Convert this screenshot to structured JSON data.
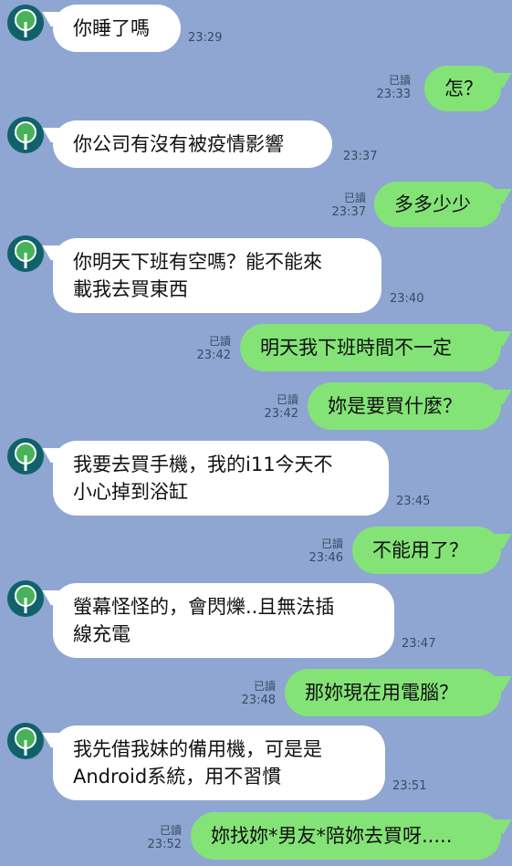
{
  "colors": {
    "background": "#8ea6d1",
    "incoming_bubble": "#ffffff",
    "outgoing_bubble": "#84e377",
    "avatar": "#11616b",
    "timestamp": "#3b4a66"
  },
  "avatar_icon": "tree-icon",
  "read_label": "已讀",
  "messages": [
    {
      "side": "in",
      "text": "你睡了嗎",
      "time": "23:29"
    },
    {
      "side": "out",
      "text": "怎？",
      "time": "23:33",
      "read": true
    },
    {
      "side": "in",
      "text": "你公司有沒有被疫情影響",
      "time": "23:37"
    },
    {
      "side": "out",
      "text": "多多少少",
      "time": "23:37",
      "read": true
    },
    {
      "side": "in",
      "text": "你明天下班有空嗎？能不能來\n載我去買東西",
      "time": "23:40"
    },
    {
      "side": "out",
      "text": "明天我下班時間不一定",
      "time": "23:42",
      "read": true
    },
    {
      "side": "out",
      "text": "妳是要買什麼？",
      "time": "23:42",
      "read": true
    },
    {
      "side": "in",
      "text": "我要去買手機，我的i11今天不\n小心掉到浴缸",
      "time": "23:45"
    },
    {
      "side": "out",
      "text": "不能用了？",
      "time": "23:46",
      "read": true
    },
    {
      "side": "in",
      "text": "螢幕怪怪的，會閃爍..且無法插\n線充電",
      "time": "23:47"
    },
    {
      "side": "out",
      "text": "那妳現在用電腦？",
      "time": "23:48",
      "read": true
    },
    {
      "side": "in",
      "text": "我先借我妹的備用機，可是是\nAndroid系統，用不習慣",
      "time": "23:51"
    },
    {
      "side": "out",
      "text": "妳找妳*男友*陪妳去買呀.....",
      "time": "23:52",
      "read": true
    }
  ]
}
